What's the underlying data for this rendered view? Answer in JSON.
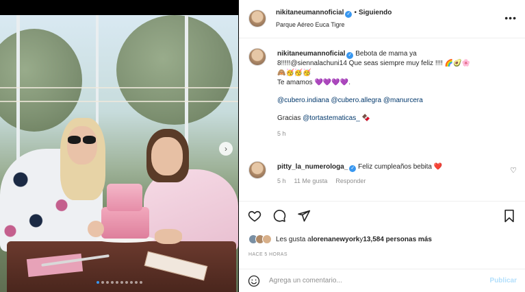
{
  "post": {
    "username": "nikitaneumannoficial",
    "follow_status": "Siguiendo",
    "location": "Parque Aéreo Euca Tigre",
    "more_icon": "more-options-icon",
    "verified_icon": "verified-badge-icon"
  },
  "caption": {
    "username": "nikitaneumannoficial",
    "line1": "Bebota de mama ya",
    "line2": "8!!!!!@siennalachuni14 Que seas siempre muy feliz !!!! 🌈🥑🌸",
    "line3": "🙈🥳🥳🥳",
    "line4": "Te amamos 💜💜💜💜.",
    "mentions": "@cubero.indiana @cubero.allegra @manurcera",
    "thanks_prefix": "Gracias ",
    "thanks_mention": "@tortastematicas_",
    "thanks_emoji": "🍫",
    "time": "5 h"
  },
  "comment": {
    "username": "pitty_la_numerologa_",
    "text": "Feliz cumpleaños bebita ❤️",
    "time": "5 h",
    "likes": "11 Me gusta",
    "reply": "Responder"
  },
  "actions": {
    "likes_prefix": "Les gusta a ",
    "likes_user": "lorenanewyork",
    "likes_middle": " y ",
    "likes_count": "13,584 personas más",
    "posted_ago": "HACE 5 HORAS"
  },
  "add_comment": {
    "placeholder": "Agrega un comentario...",
    "publish": "Publicar"
  },
  "carousel": {
    "slide_count": 10,
    "active_index": 0
  },
  "colors": {
    "accent": "#3897f0",
    "mention": "#00376b",
    "publish_disabled": "#b2dffc",
    "muted": "#8e8e8e"
  }
}
